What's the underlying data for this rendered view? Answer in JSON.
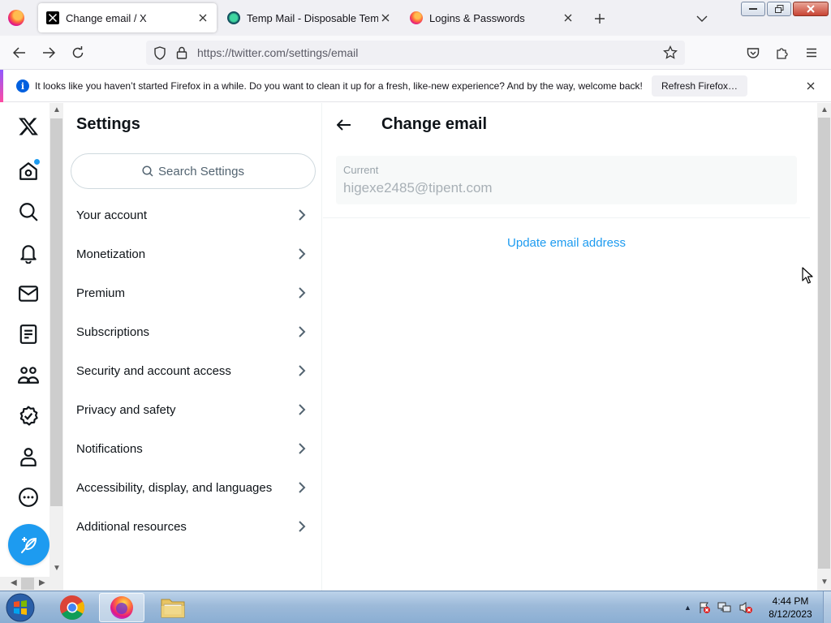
{
  "browser": {
    "tabs": [
      {
        "title": "Change email / X",
        "icon": "x-logo-icon",
        "active": true
      },
      {
        "title": "Temp Mail - Disposable Tempor",
        "icon": "temp-mail-icon",
        "active": false
      },
      {
        "title": "Logins & Passwords",
        "icon": "firefox-icon",
        "active": false
      }
    ],
    "url": "https://twitter.com/settings/email",
    "notification": {
      "message": "It looks like you haven’t started Firefox in a while. Do you want to clean it up for a fresh, like-new experience? And by the way, welcome back!",
      "button": "Refresh Firefox…"
    }
  },
  "settings": {
    "title": "Settings",
    "search_placeholder": "Search Settings",
    "items": [
      {
        "label": "Your account"
      },
      {
        "label": "Monetization"
      },
      {
        "label": "Premium"
      },
      {
        "label": "Subscriptions"
      },
      {
        "label": "Security and account access"
      },
      {
        "label": "Privacy and safety"
      },
      {
        "label": "Notifications"
      },
      {
        "label": "Accessibility, display, and languages"
      },
      {
        "label": "Additional resources"
      }
    ]
  },
  "main": {
    "title": "Change email",
    "current_label": "Current",
    "current_email": "higexe2485@tipent.com",
    "update_link": "Update email address"
  },
  "taskbar": {
    "time": "4:44 PM",
    "date": "8/12/2023"
  },
  "colors": {
    "twitter_blue": "#1d9bf0",
    "text_primary": "#0f1419",
    "text_secondary": "#536471"
  }
}
